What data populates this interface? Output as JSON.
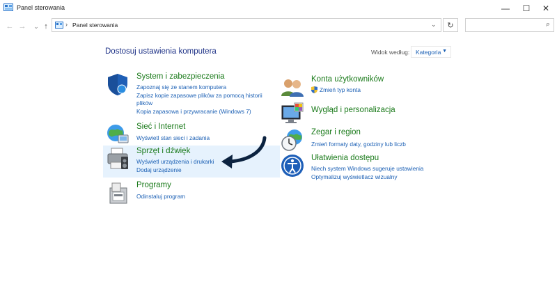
{
  "window": {
    "title": "Panel sterowania",
    "controls": [
      "—",
      "☐",
      "✕"
    ]
  },
  "address": {
    "back": "←",
    "forward": "→",
    "up": "↑",
    "separator": "›",
    "crumb": "Panel sterowania",
    "dropdown": "⌄",
    "refresh": "↻",
    "search_icon": "⌕"
  },
  "main": {
    "heading": "Dostosuj ustawienia komputera",
    "view_by_label": "Widok według:",
    "view_by_value": "Kategoria",
    "view_caret": "▼"
  },
  "categories": {
    "system": {
      "title": "System i zabezpieczenia",
      "links": [
        "Zapoznaj się ze stanem komputera",
        "Zapisz kopie zapasowe plików za pomocą historii",
        "plików",
        "Kopia zapasowa i przywracanie (Windows 7)"
      ]
    },
    "network": {
      "title": "Sieć i Internet",
      "links": [
        "Wyświetl stan sieci i zadania"
      ]
    },
    "hardware": {
      "title": "Sprzęt i dźwięk",
      "links": [
        "Wyświetl urządzenia i drukarki",
        "Dodaj urządzenie"
      ]
    },
    "programs": {
      "title": "Programy",
      "links": [
        "Odinstaluj program"
      ]
    },
    "accounts": {
      "title": "Konta użytkowników",
      "links": [
        "Zmień typ konta"
      ]
    },
    "appearance": {
      "title": "Wygląd i personalizacja",
      "links": []
    },
    "clock": {
      "title": "Zegar i region",
      "links": [
        "Zmień formaty daty, godziny lub liczb"
      ]
    },
    "ease": {
      "title": "Ułatwienia dostępu",
      "links": [
        "Niech system Windows sugeruje ustawienia",
        "Optymalizuj wyświetlacz wizualny"
      ]
    }
  },
  "colors": {
    "link_blue": "#1a5fb4",
    "category_green": "#1a7a1a",
    "heading_blue": "#1e3287",
    "highlight": "#e6f2fd",
    "arrow": "#0c2340"
  }
}
